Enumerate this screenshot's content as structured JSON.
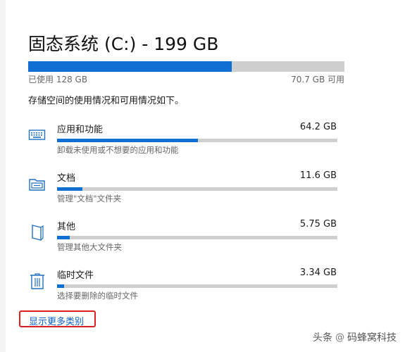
{
  "storage": {
    "title": "固态系统 (C:) - 199 GB",
    "used_fraction": 0.643,
    "used_label": "已使用 128 GB",
    "available_label": "70.7 GB 可用"
  },
  "description": "存储空间的使用情况和可用情况如下。",
  "categories": [
    {
      "name": "应用和功能",
      "size": "64.2 GB",
      "subtitle": "卸载未使用或不想要的应用和功能",
      "fraction": 0.502,
      "icon": "monitor-icon"
    },
    {
      "name": "文档",
      "size": "11.6 GB",
      "subtitle": "管理\"文档\"文件夹",
      "fraction": 0.091,
      "icon": "folder-icon"
    },
    {
      "name": "其他",
      "size": "5.75 GB",
      "subtitle": "管理其他大文件夹",
      "fraction": 0.045,
      "icon": "book-icon"
    },
    {
      "name": "临时文件",
      "size": "3.34 GB",
      "subtitle": "选择要删除的临时文件",
      "fraction": 0.026,
      "icon": "trash-icon"
    }
  ],
  "show_more_label": "显示更多类别",
  "watermark": {
    "prefix": "头条",
    "at": "@",
    "name": "码蜂窝科技"
  },
  "colors": {
    "accent": "#0f6fd3",
    "bar_track": "#cfcfcf",
    "link": "#0a5fc7",
    "highlight_box": "#e02020"
  }
}
